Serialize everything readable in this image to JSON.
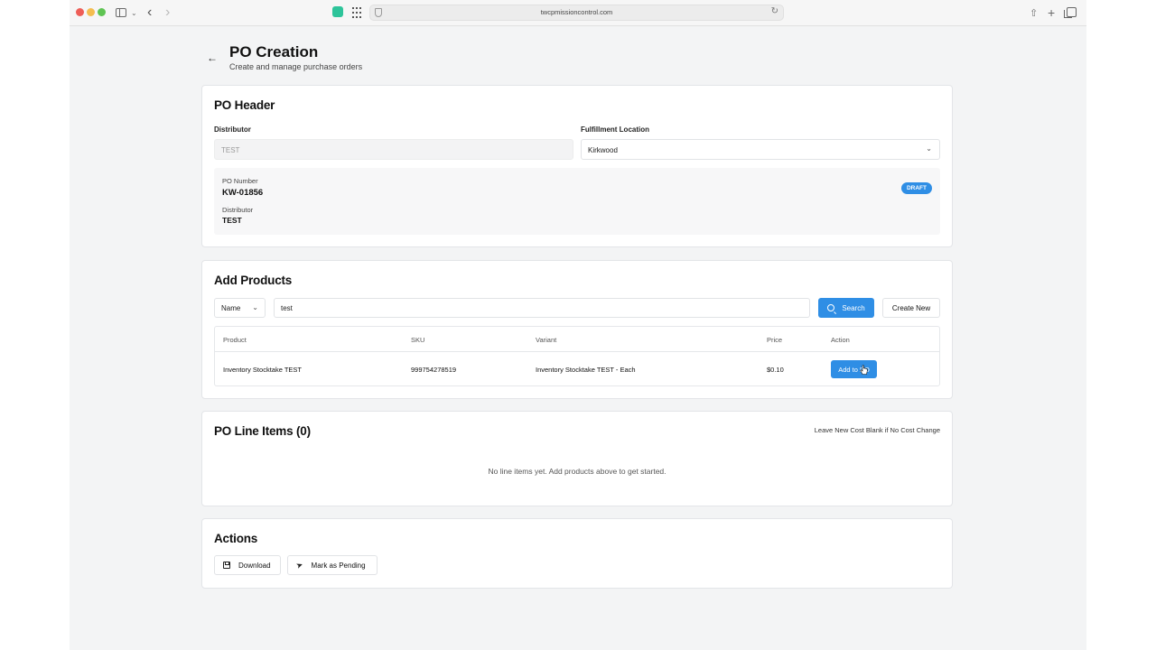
{
  "browser": {
    "url": "twcpmissioncontrol.com"
  },
  "page": {
    "title": "PO Creation",
    "subtitle": "Create and manage purchase orders"
  },
  "po_header": {
    "title": "PO Header",
    "distributor_label": "Distributor",
    "distributor_value": "TEST",
    "fulfillment_label": "Fulfillment Location",
    "fulfillment_value": "Kirkwood",
    "po_number_label": "PO Number",
    "po_number": "KW-01856",
    "info_distributor_label": "Distributor",
    "info_distributor": "TEST",
    "status_badge": "DRAFT"
  },
  "add_products": {
    "title": "Add Products",
    "search_type": "Name",
    "search_value": "test",
    "search_button": "Search",
    "create_button": "Create New",
    "columns": [
      "Product",
      "SKU",
      "Variant",
      "Price",
      "Action"
    ],
    "rows": [
      {
        "product": "Inventory Stocktake TEST",
        "sku": "999754278519",
        "variant": "Inventory Stocktake TEST - Each",
        "price": "$0.10",
        "action": "Add to PO"
      }
    ]
  },
  "line_items": {
    "title": "PO Line Items (0)",
    "note": "Leave New Cost Blank if No Cost Change",
    "empty": "No line items yet. Add products above to get started."
  },
  "actions": {
    "title": "Actions",
    "download": "Download",
    "mark_pending": "Mark as Pending"
  },
  "colors": {
    "primary": "#2f8ee5",
    "background": "#f3f4f5"
  }
}
